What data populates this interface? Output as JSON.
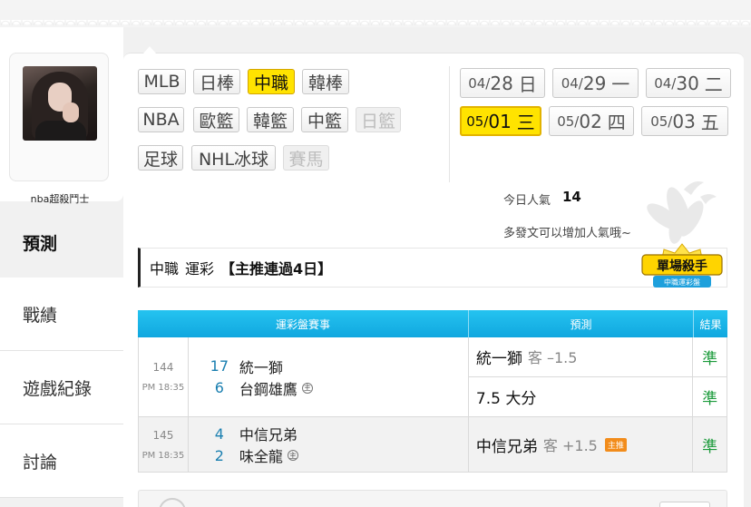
{
  "user": {
    "name": "nba超殺鬥士"
  },
  "menu": [
    {
      "label": "預測",
      "active": true
    },
    {
      "label": "戰績"
    },
    {
      "label": "遊戲紀錄"
    },
    {
      "label": "討論"
    }
  ],
  "sports": [
    {
      "label": "MLB",
      "state": "normal"
    },
    {
      "label": "日棒",
      "state": "normal"
    },
    {
      "label": "中職",
      "state": "active"
    },
    {
      "label": "韓棒",
      "state": "normal"
    },
    {
      "label": "NBA",
      "state": "normal"
    },
    {
      "label": "歐籃",
      "state": "normal"
    },
    {
      "label": "韓籃",
      "state": "normal"
    },
    {
      "label": "中籃",
      "state": "normal"
    },
    {
      "label": "日籃",
      "state": "disabled"
    },
    {
      "label": "足球",
      "state": "normal"
    },
    {
      "label": "NHL冰球",
      "state": "normal"
    },
    {
      "label": "賽馬",
      "state": "disabled"
    }
  ],
  "dates": [
    {
      "month": "04/",
      "day": "28",
      "weekday": "日"
    },
    {
      "month": "04/",
      "day": "29",
      "weekday": "一"
    },
    {
      "month": "04/",
      "day": "30",
      "weekday": "二"
    },
    {
      "month": "05/",
      "day": "01",
      "weekday": "三",
      "active": true
    },
    {
      "month": "05/",
      "day": "02",
      "weekday": "四"
    },
    {
      "month": "05/",
      "day": "03",
      "weekday": "五"
    }
  ],
  "popularity": {
    "label": "今日人氣",
    "value": "14",
    "hint": "多發文可以增加人氣哦~"
  },
  "title": {
    "league": "中職",
    "type": "運彩",
    "tag": "【主推連過4日】"
  },
  "badge": {
    "line1": "單場殺手",
    "line2": "中職運彩盤"
  },
  "table": {
    "headers": {
      "game": "運彩盤賽事",
      "prediction": "預測",
      "result": "結果"
    },
    "rows": [
      {
        "num": "144",
        "time": "PM 18:35",
        "away": {
          "score": "17",
          "name": "統一獅"
        },
        "home": {
          "score": "6",
          "name": "台鋼雄鷹",
          "mark": "主"
        },
        "predictions": [
          {
            "text": "統一獅",
            "sub": "客 –1.5",
            "result": "準"
          },
          {
            "text": "7.5 大分",
            "sub": "",
            "result": "準"
          }
        ]
      },
      {
        "num": "145",
        "time": "PM 18:35",
        "away": {
          "score": "4",
          "name": "中信兄弟"
        },
        "home": {
          "score": "2",
          "name": "味全龍",
          "mark": "主"
        },
        "predictions": [
          {
            "text": "中信兄弟",
            "sub": "客 +1.5",
            "ribbon": "主推",
            "result": "準"
          }
        ]
      }
    ]
  },
  "colors": {
    "accent_yellow": "#ffe300",
    "header_blue": "#18b4e8",
    "score_blue": "#1a7fb0",
    "result_green": "#1a9a3a"
  }
}
